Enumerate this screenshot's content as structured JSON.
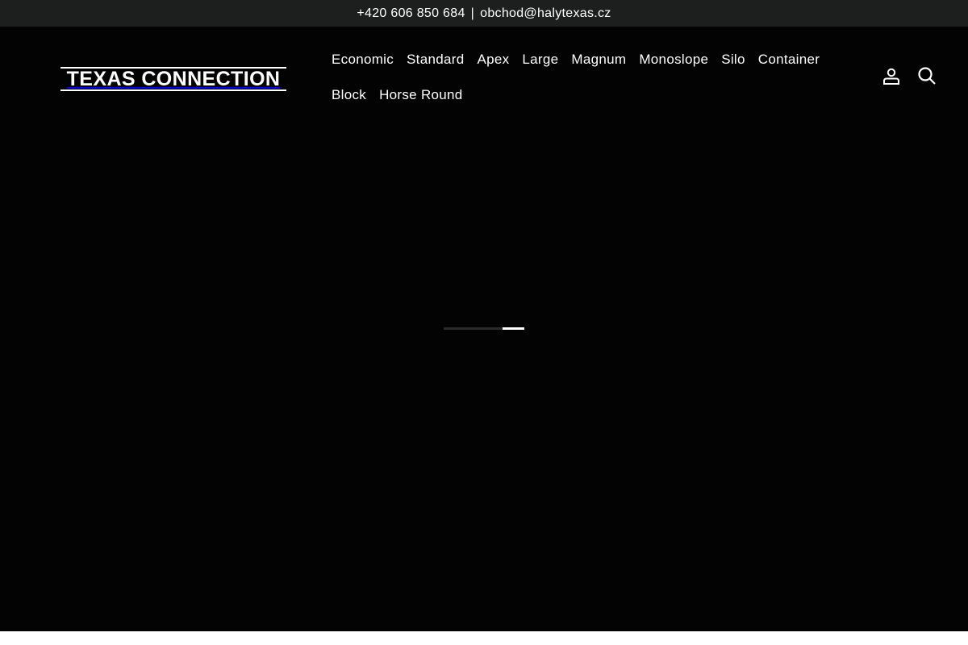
{
  "announcement": {
    "phone": "+420 606 850 684",
    "separator": "|",
    "email": "obchod@halytexas.cz"
  },
  "logo": {
    "text": "TEXAS CONNECTION"
  },
  "nav": {
    "items": [
      "Economic",
      "Standard",
      "Apex",
      "Large",
      "Magnum",
      "Monoslope",
      "Silo",
      "Container",
      "Block",
      "Horse Round"
    ]
  },
  "icons": {
    "account": "user-icon",
    "search": "search-icon",
    "account_label": "Log in",
    "search_label": "Search"
  },
  "colors": {
    "announcement_bg": "#1d1f1f",
    "hero_bg": "#030303",
    "text": "#ffffff",
    "loader_track": "#2a2a2a",
    "loader_fill": "#ffffff"
  },
  "loader": {
    "progress_start": 0.73,
    "progress_end": 1.0
  }
}
